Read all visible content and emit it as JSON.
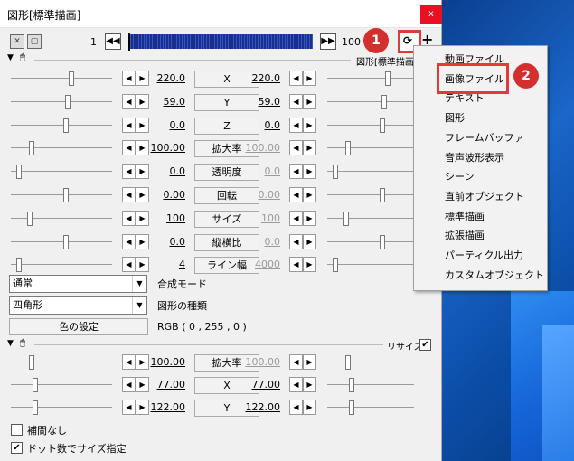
{
  "window": {
    "title": "図形[標準描画]",
    "close": "x"
  },
  "toolbar": {
    "frame_start": "1",
    "frame_end": "100",
    "prev": "◀◀",
    "next": "▶▶",
    "add": "+",
    "loop_icon": "loop-icon"
  },
  "section1": {
    "header_label": "図形[標準描画",
    "params": [
      {
        "left": "220.0",
        "name": "X",
        "right": "220.0",
        "right_gray": false
      },
      {
        "left": "59.0",
        "name": "Y",
        "right": "59.0",
        "right_gray": false
      },
      {
        "left": "0.0",
        "name": "Z",
        "right": "0.0",
        "right_gray": false
      },
      {
        "left": "100.00",
        "name": "拡大率",
        "right": "100.00",
        "right_gray": true
      },
      {
        "left": "0.0",
        "name": "透明度",
        "right": "0.0",
        "right_gray": true
      },
      {
        "left": "0.00",
        "name": "回転",
        "right": "0.00",
        "right_gray": true
      },
      {
        "left": "100",
        "name": "サイズ",
        "right": "100",
        "right_gray": true
      },
      {
        "left": "0.0",
        "name": "縦横比",
        "right": "0.0",
        "right_gray": true
      },
      {
        "left": "4",
        "name": "ライン幅",
        "right": "4000",
        "right_gray": true
      }
    ],
    "blend_select": "通常",
    "blend_label": "合成モード",
    "shape_select": "四角形",
    "shape_label": "図形の種類",
    "color_button": "色の設定",
    "color_value": "RGB ( 0 , 255 , 0 )"
  },
  "section2": {
    "resize_label": "リサイズ",
    "resize_checked": "✔",
    "params": [
      {
        "left": "100.00",
        "name": "拡大率",
        "right": "100.00",
        "right_gray": true
      },
      {
        "left": "77.00",
        "name": "X",
        "right": "77.00",
        "right_gray": false
      },
      {
        "left": "122.00",
        "name": "Y",
        "right": "122.00",
        "right_gray": false
      }
    ],
    "no_interp": "補間なし",
    "dot_size": "ドット数でサイズ指定",
    "dot_checked": "✔"
  },
  "menu": {
    "items": [
      "動画ファイル",
      "画像ファイル",
      "テキスト",
      "図形",
      "フレームバッファ",
      "音声波形表示",
      "シーン",
      "直前オブジェクト",
      "標準描画",
      "拡張描画",
      "パーティクル出力",
      "カスタムオブジェクト"
    ]
  },
  "callouts": {
    "one": "1",
    "two": "2"
  },
  "colors": {
    "callout_red": "#d32f2f",
    "timeline_blue": "#1a2f8a",
    "close_red": "#e81123"
  }
}
